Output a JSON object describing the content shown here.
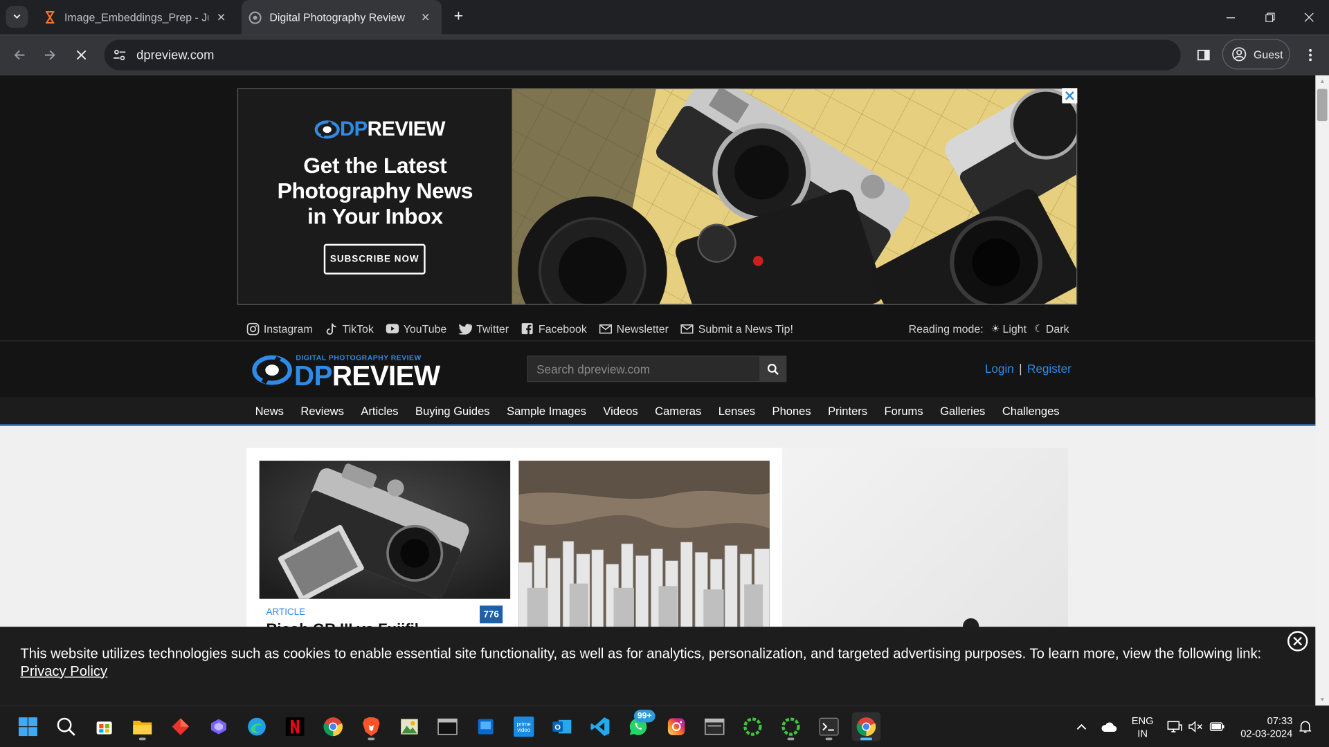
{
  "browser": {
    "tabs": [
      {
        "title": "Image_Embeddings_Prep - Jupy",
        "favicon": "jupyter-hourglass-icon",
        "active": false
      },
      {
        "title": "Digital Photography Review",
        "favicon": "dpreview-favicon",
        "active": true
      }
    ],
    "url": "dpreview.com",
    "profile_label": "Guest",
    "loading": true
  },
  "ad": {
    "logo_prefix": "DP",
    "logo_suffix": "REVIEW",
    "headline": [
      "Get the Latest",
      "Photography News",
      "in Your Inbox"
    ],
    "button": "SUBSCRIBE NOW"
  },
  "social": [
    {
      "label": "Instagram",
      "icon": "instagram-icon"
    },
    {
      "label": "TikTok",
      "icon": "tiktok-icon"
    },
    {
      "label": "YouTube",
      "icon": "youtube-icon"
    },
    {
      "label": "Twitter",
      "icon": "twitter-icon"
    },
    {
      "label": "Facebook",
      "icon": "facebook-icon"
    },
    {
      "label": "Newsletter",
      "icon": "mail-icon"
    },
    {
      "label": "Submit a News Tip!",
      "icon": "mail-icon"
    }
  ],
  "reading_mode": {
    "label": "Reading mode:",
    "light": "Light",
    "dark": "Dark"
  },
  "header": {
    "tagline": "DIGITAL PHOTOGRAPHY REVIEW",
    "logo_prefix": "DP",
    "logo_suffix": "REVIEW",
    "search_placeholder": "Search dpreview.com",
    "login": "Login",
    "separator": "|",
    "register": "Register"
  },
  "nav": [
    "News",
    "Reviews",
    "Articles",
    "Buying Guides",
    "Sample Images",
    "Videos",
    "Cameras",
    "Lenses",
    "Phones",
    "Printers",
    "Forums",
    "Galleries",
    "Challenges"
  ],
  "article": {
    "kicker": "ARTICLE",
    "comment_count": "776",
    "title_fragment": "Ricoh GR III vs Fujifil"
  },
  "cookie": {
    "text": "This website utilizes technologies such as cookies to enable essential site functionality, as well as for analytics, personalization, and targeted advertising purposes. To learn more, view the following link:",
    "link": "Privacy Policy"
  },
  "taskbar": {
    "whatsapp_badge": "99+",
    "language": "ENG",
    "region": "IN",
    "time": "07:33",
    "date": "02-03-2024"
  },
  "colors": {
    "accent": "#2e8be8",
    "page_dark": "#141414",
    "chrome_dark": "#202124",
    "chrome_toolbar": "#35363a"
  }
}
